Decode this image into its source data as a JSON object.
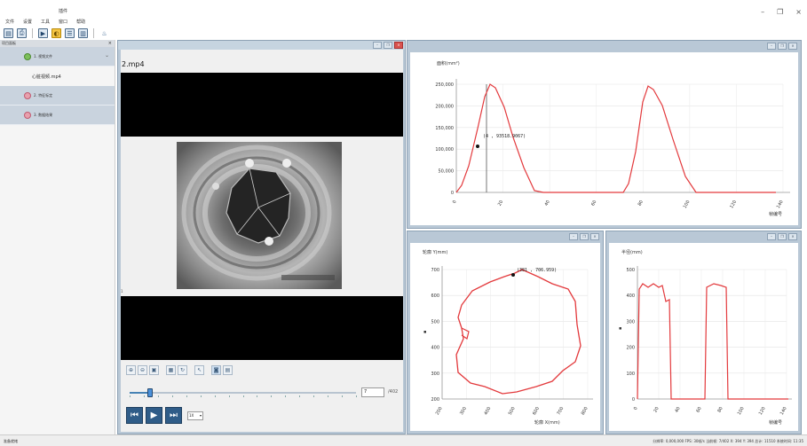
{
  "window": {
    "title": "插件",
    "minimize": "–",
    "maximize": "❐",
    "close": "×"
  },
  "menu": [
    "文件",
    "设置",
    "工具",
    "窗口",
    "帮助"
  ],
  "toolbar": [
    "save-icon",
    "export-icon",
    "open-icon",
    "refresh-icon",
    "list-icon",
    "split-icon",
    "flame-icon"
  ],
  "left_panel": {
    "header": "项目面板",
    "close": "×",
    "items": [
      {
        "label": "1. 视频文件",
        "color": "#7dbf5b"
      },
      {
        "label": "心脏视频.mp4",
        "sub": true
      },
      {
        "label": "2. 特征标定",
        "color": "#e06f86"
      },
      {
        "label": "3. 数据结果",
        "color": "#e06f86"
      }
    ]
  },
  "video": {
    "file_name": "2.mp4",
    "frame_label": "1",
    "frame_value": "7",
    "frame_unit": "/402",
    "slider_progress": 0.09,
    "speed": "1X",
    "toolbar_icons": [
      "zoom-in-icon",
      "zoom-out-icon",
      "fit-icon",
      "crop-icon",
      "rotate-icon",
      "cursor-icon",
      "camera-icon",
      "grid-icon"
    ]
  },
  "charts": {
    "area": {
      "ylabel": "面积(mm²)",
      "xlabel": "帧编号",
      "yticks": [
        "250,000",
        "200,000",
        "150,000",
        "100,000",
        "50,000",
        "0"
      ],
      "xticks": [
        "0",
        "20",
        "40",
        "60",
        "80",
        "100",
        "120",
        "140"
      ],
      "annotation": "(4 , 93518.9067)",
      "color": "#e3393c"
    },
    "radius": {
      "ylabel": "轮廓 Y(mm)",
      "xlabel": "轮廓 X(mm)",
      "yticks": [
        "700",
        "600",
        "500",
        "400",
        "300",
        "200"
      ],
      "xticks": [
        "200",
        "300",
        "400",
        "500",
        "600",
        "700",
        "800"
      ],
      "annotation": "(381 , 706.959)",
      "color": "#e3393c"
    },
    "r": {
      "ylabel": "半径(mm)",
      "xlabel": "帧编号",
      "yticks": [
        "500",
        "400",
        "300",
        "200",
        "100",
        "0"
      ],
      "xticks": [
        "0",
        "20",
        "40",
        "60",
        "80",
        "100",
        "120",
        "140"
      ],
      "color": "#e3393c"
    }
  },
  "status": {
    "left": "准备就绪",
    "right": "分辨率: 0,000,000 FPS: 30帧/s 当前帧: 7/402 X: 394 Y: 394 总计: 11510 系统时间: 11:35"
  }
}
